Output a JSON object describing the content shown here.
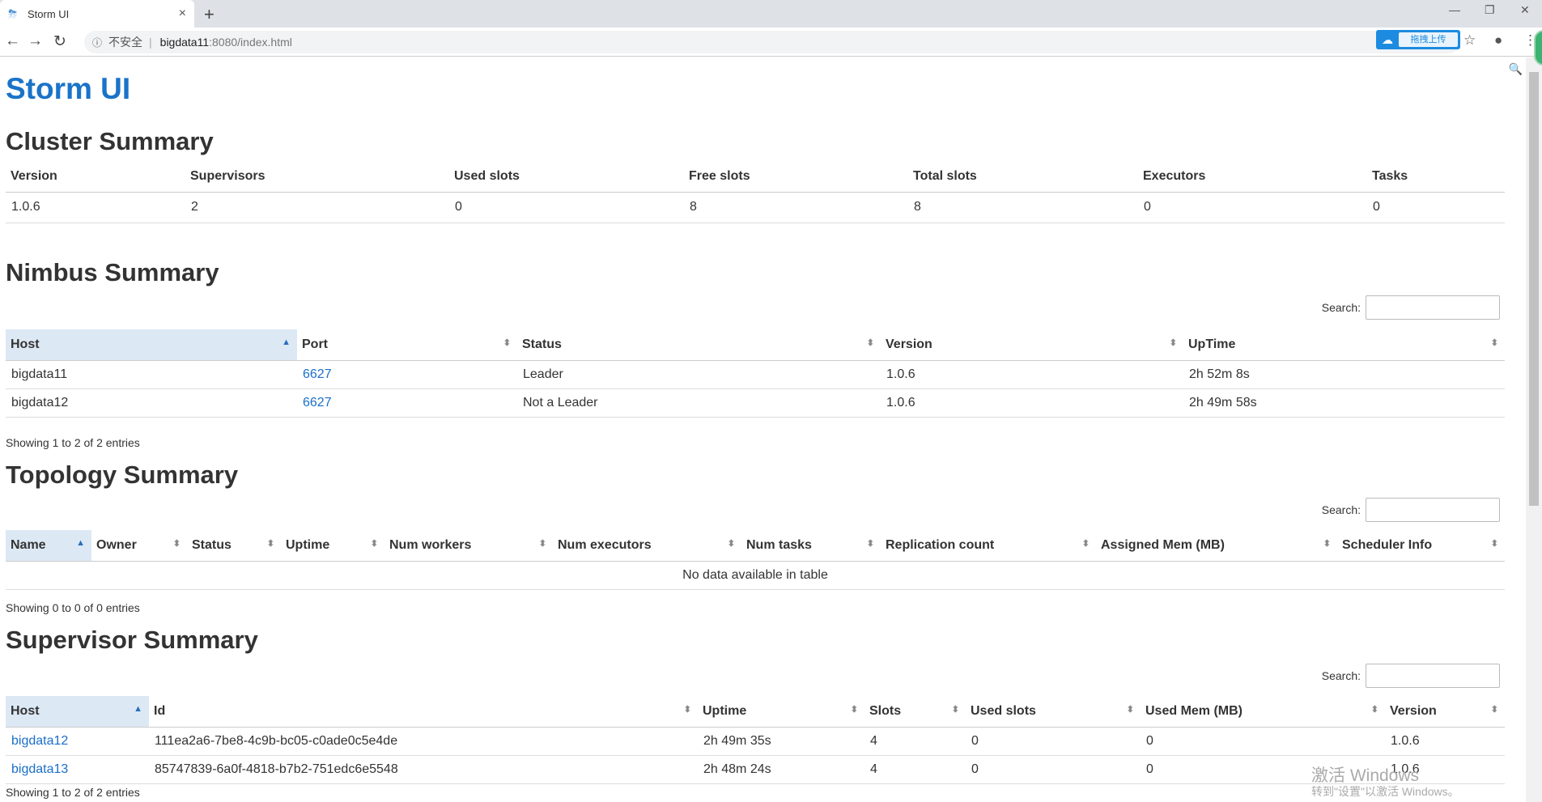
{
  "browser": {
    "tab_title": "Storm UI",
    "new_tab": "+",
    "url_insecure": "不安全",
    "url_host": "bigdata11",
    "url_path": ":8080/index.html",
    "ext_label": "拖拽上传"
  },
  "page_title": "Storm UI",
  "cluster": {
    "heading": "Cluster Summary",
    "columns": [
      "Version",
      "Supervisors",
      "Used slots",
      "Free slots",
      "Total slots",
      "Executors",
      "Tasks"
    ],
    "row": [
      "1.0.6",
      "2",
      "0",
      "8",
      "8",
      "0",
      "0"
    ]
  },
  "nimbus": {
    "heading": "Nimbus Summary",
    "search_label": "Search:",
    "columns": [
      "Host",
      "Port",
      "Status",
      "Version",
      "UpTime"
    ],
    "rows": [
      [
        "bigdata11",
        "6627",
        "Leader",
        "1.0.6",
        "2h 52m 8s"
      ],
      [
        "bigdata12",
        "6627",
        "Not a Leader",
        "1.0.6",
        "2h 49m 58s"
      ]
    ],
    "info": "Showing 1 to 2 of 2 entries"
  },
  "topology": {
    "heading": "Topology Summary",
    "search_label": "Search:",
    "columns": [
      "Name",
      "Owner",
      "Status",
      "Uptime",
      "Num workers",
      "Num executors",
      "Num tasks",
      "Replication count",
      "Assigned Mem (MB)",
      "Scheduler Info"
    ],
    "empty": "No data available in table",
    "info": "Showing 0 to 0 of 0 entries"
  },
  "supervisor": {
    "heading": "Supervisor Summary",
    "search_label": "Search:",
    "columns": [
      "Host",
      "Id",
      "Uptime",
      "Slots",
      "Used slots",
      "Used Mem (MB)",
      "Version"
    ],
    "rows": [
      [
        "bigdata12",
        "111ea2a6-7be8-4c9b-bc05-c0ade0c5e4de",
        "2h 49m 35s",
        "4",
        "0",
        "0",
        "1.0.6"
      ],
      [
        "bigdata13",
        "85747839-6a0f-4818-b7b2-751edc6e5548",
        "2h 48m 24s",
        "4",
        "0",
        "0",
        "1.0.6"
      ]
    ],
    "info": "Showing 1 to 2 of 2 entries"
  },
  "watermark": {
    "line1": "激活 Windows",
    "line2": "转到\"设置\"以激活 Windows。"
  }
}
